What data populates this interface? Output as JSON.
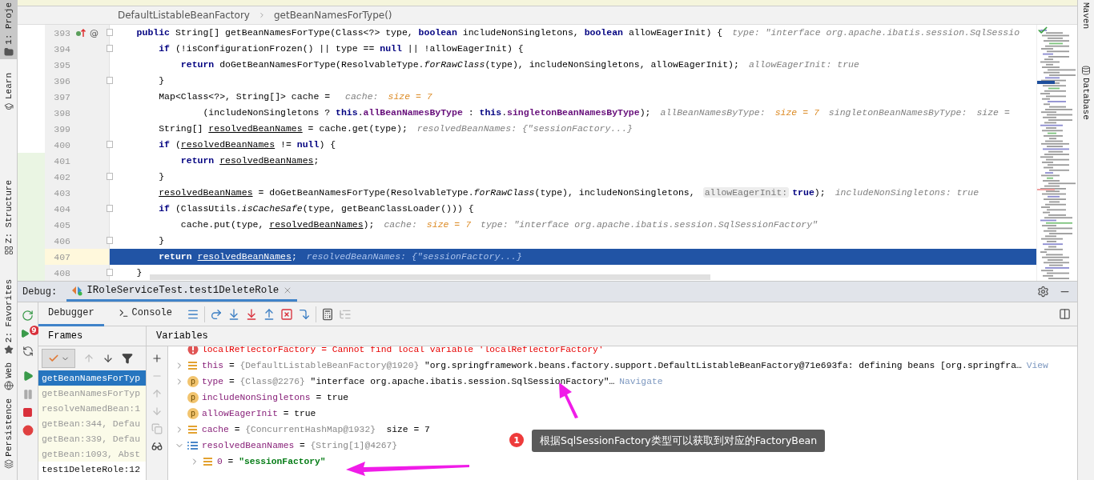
{
  "left_tools": [
    {
      "label": "1: Proje",
      "kind": "project",
      "selected": true
    },
    {
      "label": "Learn",
      "kind": "learn",
      "selected": false
    },
    {
      "label": "Z: Structure",
      "kind": "structure",
      "selected": false
    },
    {
      "label": "2: Favorites",
      "kind": "favorites",
      "selected": false
    },
    {
      "label": "Web",
      "kind": "web",
      "selected": false
    },
    {
      "label": "Persistence",
      "kind": "persistence",
      "selected": false
    }
  ],
  "right_tools": [
    {
      "label": "Maven",
      "kind": "maven"
    },
    {
      "label": "Database",
      "kind": "database"
    }
  ],
  "editor": {
    "breadcrumb": [
      "DefaultListableBeanFactory",
      "getBeanNamesForType()"
    ],
    "lines": [
      {
        "number": "393",
        "current": false,
        "changed": false,
        "fold": true,
        "override_marker": true,
        "gutter_mark": "@",
        "tokens": [
          {
            "kind": "keyword",
            "text": "    public"
          },
          {
            "kind": "plain",
            "text": " String[] getBeanNamesForType(Class<?> type, "
          },
          {
            "kind": "keyword",
            "text": "boolean"
          },
          {
            "kind": "plain",
            "text": " includeNonSingletons, "
          },
          {
            "kind": "keyword",
            "text": "boolean"
          },
          {
            "kind": "plain",
            "text": " allowEagerInit) {"
          },
          {
            "kind": "hint",
            "text": "type: \"interface org.apache.ibatis.session.SqlSessio"
          }
        ]
      },
      {
        "number": "394",
        "current": false,
        "changed": false,
        "fold": true,
        "override_marker": false,
        "tokens": [
          {
            "kind": "keyword",
            "text": "        if"
          },
          {
            "kind": "plain",
            "text": " (!isConfigurationFrozen() || type == "
          },
          {
            "kind": "keyword",
            "text": "null"
          },
          {
            "kind": "plain",
            "text": " || !allowEagerInit) {"
          }
        ]
      },
      {
        "number": "395",
        "current": false,
        "changed": false,
        "fold": false,
        "override_marker": false,
        "tokens": [
          {
            "kind": "keyword",
            "text": "            return"
          },
          {
            "kind": "plain",
            "text": " doGetBeanNamesForType(ResolvableType."
          },
          {
            "kind": "italic",
            "text": "forRawClass"
          },
          {
            "kind": "plain",
            "text": "(type), includeNonSingletons, allowEagerInit);"
          },
          {
            "kind": "hint",
            "text": "allowEagerInit: true"
          }
        ]
      },
      {
        "number": "396",
        "current": false,
        "changed": false,
        "fold": true,
        "override_marker": false,
        "tokens": [
          {
            "kind": "plain",
            "text": "        }"
          }
        ]
      },
      {
        "number": "397",
        "current": false,
        "changed": false,
        "fold": false,
        "override_marker": false,
        "tokens": [
          {
            "kind": "plain",
            "text": "        Map<Class<?>, String[]> cache = "
          },
          {
            "kind": "hint",
            "text": "cache:"
          },
          {
            "kind": "number",
            "text": "size = 7"
          }
        ]
      },
      {
        "number": "398",
        "current": false,
        "changed": false,
        "fold": false,
        "override_marker": false,
        "tokens": [
          {
            "kind": "plain",
            "text": "                (includeNonSingletons ? "
          },
          {
            "kind": "keyword",
            "text": "this"
          },
          {
            "kind": "plain",
            "text": "."
          },
          {
            "kind": "field",
            "text": "allBeanNamesByType"
          },
          {
            "kind": "plain",
            "text": " : "
          },
          {
            "kind": "keyword",
            "text": "this"
          },
          {
            "kind": "plain",
            "text": "."
          },
          {
            "kind": "field",
            "text": "singletonBeanNamesByType"
          },
          {
            "kind": "plain",
            "text": ");"
          },
          {
            "kind": "hint",
            "text": "allBeanNamesByType:"
          },
          {
            "kind": "number",
            "text": "size = 7"
          },
          {
            "kind": "hint",
            "text": "singletonBeanNamesByType:"
          },
          {
            "kind": "hint",
            "text": "size ="
          }
        ]
      },
      {
        "number": "399",
        "current": false,
        "changed": false,
        "fold": false,
        "override_marker": false,
        "tokens": [
          {
            "kind": "plain",
            "text": "        String[] "
          },
          {
            "kind": "local",
            "text": "resolvedBeanNames"
          },
          {
            "kind": "plain",
            "text": " = cache.get(type);"
          },
          {
            "kind": "hint",
            "text": "resolvedBeanNames: {\"sessionFactory...}"
          }
        ]
      },
      {
        "number": "400",
        "current": false,
        "changed": false,
        "fold": true,
        "override_marker": false,
        "tokens": [
          {
            "kind": "keyword",
            "text": "        if"
          },
          {
            "kind": "plain",
            "text": " ("
          },
          {
            "kind": "local",
            "text": "resolvedBeanNames"
          },
          {
            "kind": "plain",
            "text": " != "
          },
          {
            "kind": "keyword",
            "text": "null"
          },
          {
            "kind": "plain",
            "text": ") {"
          }
        ]
      },
      {
        "number": "401",
        "current": false,
        "changed": true,
        "fold": false,
        "override_marker": false,
        "tokens": [
          {
            "kind": "keyword",
            "text": "            return "
          },
          {
            "kind": "local",
            "text": "resolvedBeanNames"
          },
          {
            "kind": "plain",
            "text": ";"
          }
        ]
      },
      {
        "number": "402",
        "current": false,
        "changed": true,
        "fold": true,
        "override_marker": false,
        "tokens": [
          {
            "kind": "plain",
            "text": "        }"
          }
        ]
      },
      {
        "number": "403",
        "current": false,
        "changed": true,
        "fold": false,
        "override_marker": false,
        "tokens": [
          {
            "kind": "local",
            "text": "        resolvedBeanNames"
          },
          {
            "kind": "plain",
            "text": " = doGetBeanNamesForType(ResolvableType."
          },
          {
            "kind": "italic",
            "text": "forRawClass"
          },
          {
            "kind": "plain",
            "text": "(type), includeNonSingletons,"
          },
          {
            "kind": "param",
            "text": "allowEagerInit:"
          },
          {
            "kind": "keyword",
            "text": "true"
          },
          {
            "kind": "plain",
            "text": ");"
          },
          {
            "kind": "hint",
            "text": "includeNonSingletons: true"
          }
        ]
      },
      {
        "number": "404",
        "current": false,
        "changed": true,
        "fold": true,
        "override_marker": false,
        "tokens": [
          {
            "kind": "keyword",
            "text": "        if"
          },
          {
            "kind": "plain",
            "text": " (ClassUtils."
          },
          {
            "kind": "italic",
            "text": "isCacheSafe"
          },
          {
            "kind": "plain",
            "text": "(type, getBeanClassLoader())) {"
          }
        ]
      },
      {
        "number": "405",
        "current": false,
        "changed": true,
        "fold": false,
        "override_marker": false,
        "tokens": [
          {
            "kind": "plain",
            "text": "            cache.put(type, "
          },
          {
            "kind": "local",
            "text": "resolvedBeanNames"
          },
          {
            "kind": "plain",
            "text": ");"
          },
          {
            "kind": "hint",
            "text": "cache:"
          },
          {
            "kind": "number",
            "text": "size = 7"
          },
          {
            "kind": "hint",
            "text": "type: \"interface org.apache.ibatis.session.SqlSessionFactory\""
          }
        ]
      },
      {
        "number": "406",
        "current": false,
        "changed": true,
        "fold": true,
        "override_marker": false,
        "tokens": [
          {
            "kind": "plain",
            "text": "        }"
          }
        ]
      },
      {
        "number": "407",
        "current": true,
        "changed": true,
        "fold": false,
        "override_marker": false,
        "tokens": [
          {
            "kind": "keyword",
            "text": "        return "
          },
          {
            "kind": "local",
            "text": "resolvedBeanNames"
          },
          {
            "kind": "plain",
            "text": ";"
          },
          {
            "kind": "hint",
            "text": "resolvedBeanNames: {\"sessionFactory...}"
          }
        ]
      },
      {
        "number": "408",
        "current": false,
        "changed": true,
        "fold": true,
        "override_marker": false,
        "tokens": [
          {
            "kind": "plain",
            "text": "    }"
          }
        ]
      }
    ]
  },
  "debug": {
    "label": "Debug:",
    "session": "IRoleServiceTest.test1DeleteRole",
    "resume_badge": "9",
    "tabs": [
      {
        "label": "Debugger",
        "selected": true
      },
      {
        "label": "Console",
        "selected": false
      }
    ],
    "frames_title": "Frames",
    "variables_title": "Variables",
    "frames": [
      {
        "label": "getBeanNamesForTyp",
        "selected": true,
        "library": true
      },
      {
        "label": "getBeanNamesForTyp",
        "selected": false,
        "library": true
      },
      {
        "label": "resolveNamedBean:1",
        "selected": false,
        "library": true
      },
      {
        "label": "getBean:344, Defau",
        "selected": false,
        "library": true
      },
      {
        "label": "getBean:339, Defau",
        "selected": false,
        "library": true
      },
      {
        "label": "getBean:1093, Abst",
        "selected": false,
        "library": true
      },
      {
        "label": "test1DeleteRole:12",
        "selected": false,
        "library": false
      }
    ],
    "variables": [
      {
        "kind": "error",
        "name": "localReflectorFactory",
        "eq": "=",
        "value": "Cannot find local variable 'localReflectorFactory'"
      },
      {
        "kind": "field",
        "name": "this",
        "eq": "=",
        "ref": "{DefaultListableBeanFactory@1920}",
        "value": "\"org.springframework.beans.factory.support.DefaultListableBeanFactory@71e693fa: defining beans [org.springfra…",
        "link": "View",
        "expanded": false
      },
      {
        "kind": "param",
        "badge": "p",
        "name": "type",
        "eq": "=",
        "ref": "{Class@2276}",
        "value": "\"interface org.apache.ibatis.session.SqlSessionFactory\"…",
        "link": "Navigate",
        "expanded": false
      },
      {
        "kind": "param",
        "badge": "p",
        "name": "includeNonSingletons",
        "eq": "=",
        "value": "true"
      },
      {
        "kind": "param",
        "badge": "p",
        "name": "allowEagerInit",
        "eq": "=",
        "value": "true"
      },
      {
        "kind": "field",
        "name": "cache",
        "eq": "=",
        "ref": "{ConcurrentHashMap@1932}",
        "value": "size = 7",
        "expanded": false
      },
      {
        "kind": "array",
        "name": "resolvedBeanNames",
        "eq": "=",
        "ref": "{String[1]@4267}",
        "expanded": true,
        "children": [
          {
            "kind": "field",
            "name": "0",
            "eq": "=",
            "value": "\"sessionFactory\"",
            "string": true,
            "expanded": false
          }
        ]
      }
    ]
  },
  "annotation": {
    "number": "1",
    "text": "根据SqlSessionFactory类型可以获取到对应的FactoryBean"
  }
}
